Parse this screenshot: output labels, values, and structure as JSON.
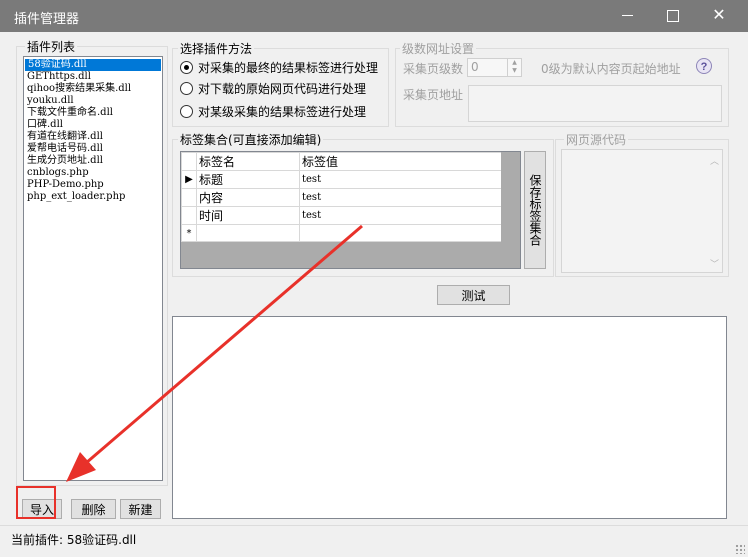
{
  "window": {
    "title": "插件管理器",
    "minimize_label": "—",
    "close_label": "✕"
  },
  "plugin_list": {
    "legend": "插件列表",
    "items": [
      "58验证码.dll",
      "GEThttps.dll",
      "qihoo搜索结果采集.dll",
      "youku.dll",
      "下载文件重命名.dll",
      "口碑.dll",
      "有道在线翻译.dll",
      "爱帮电话号码.dll",
      "生成分页地址.dll",
      "cnblogs.php",
      "PHP-Demo.php",
      "php_ext_loader.php"
    ],
    "selected_index": 0,
    "import_label": "导入",
    "delete_label": "删除",
    "new_label": "新建"
  },
  "method": {
    "legend": "选择插件方法",
    "options": [
      "对采集的最终的结果标签进行处理",
      "对下载的原始网页代码进行处理",
      "对某级采集的结果标签进行处理"
    ],
    "selected_index": 0
  },
  "levels": {
    "legend": "级数网址设置",
    "page_levels_label": "采集页级数",
    "page_levels_value": "0",
    "hint": "0级为默认内容页起始地址",
    "help_icon": "?",
    "page_url_label": "采集页地址"
  },
  "tags": {
    "legend": "标签集合(可直接添加编辑)",
    "columns": [
      "标签名",
      "标签值"
    ],
    "rows": [
      {
        "name": "标题",
        "value": "test"
      },
      {
        "name": "内容",
        "value": "test"
      },
      {
        "name": "时间",
        "value": "test"
      }
    ],
    "new_row_marker": "*",
    "current_row_marker": "▶",
    "save_label": "保存标签集合"
  },
  "source": {
    "legend": "网页源代码",
    "scroll_up": "︿",
    "scroll_down": "﹀"
  },
  "test_label": "测试",
  "status": {
    "current_plugin": "当前插件: 58验证码.dll"
  },
  "colors": {
    "titlebar": "#7a7a7a",
    "selection": "#0078d7",
    "annotation": "#e8312a"
  },
  "icons": {
    "help": "question-icon",
    "grip": "resize-grip-icon"
  }
}
